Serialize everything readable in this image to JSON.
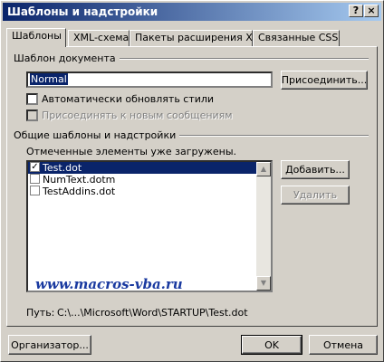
{
  "window": {
    "title": "Шаблоны и надстройки",
    "help_glyph": "?",
    "close_glyph": "×"
  },
  "tabs": [
    {
      "label": "Шаблоны",
      "active": true
    },
    {
      "label": "XML-схема",
      "active": false
    },
    {
      "label": "Пакеты расширения XML",
      "active": false
    },
    {
      "label": "Связанные CSS",
      "active": false
    }
  ],
  "document_template": {
    "group_label": "Шаблон документа",
    "template_value": "Normal",
    "attach_button": "Присоединить...",
    "auto_update_label": "Автоматически обновлять стили",
    "auto_update_checked": false,
    "attach_new_messages_label": "Присоединять к новым сообщениям",
    "attach_new_messages_checked": false
  },
  "global_templates": {
    "group_label": "Общие шаблоны и надстройки",
    "note": "Отмеченные элементы уже загружены.",
    "items": [
      {
        "name": "Test.dot",
        "checked": true,
        "selected": true
      },
      {
        "name": "NumText.dotm",
        "checked": false,
        "selected": false
      },
      {
        "name": "TestAddins.dot",
        "checked": false,
        "selected": false
      }
    ],
    "add_button": "Добавить...",
    "remove_button": "Удалить",
    "watermark": "www.macros-vba.ru",
    "path_label": "Путь:",
    "path_value": "C:\\...\\Microsoft\\Word\\STARTUP\\Test.dot"
  },
  "footer": {
    "organizer_button": "Организатор...",
    "ok_button": "OK",
    "cancel_button": "Отмена"
  },
  "icons": {
    "check": "✓",
    "scroll_up": "▲",
    "scroll_down": "▼"
  }
}
